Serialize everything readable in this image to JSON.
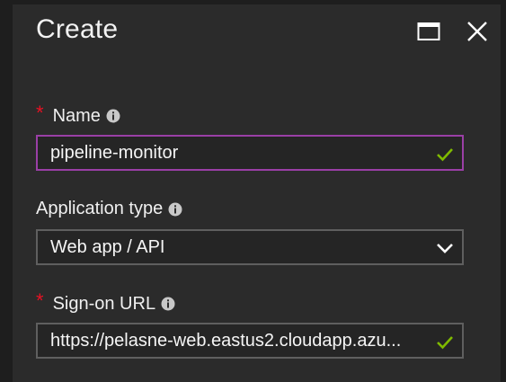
{
  "blade": {
    "title": "Create",
    "maximize_icon": "maximize-icon",
    "close_icon": "close-icon"
  },
  "form": {
    "name": {
      "label": "Name",
      "required": true,
      "value": "pipeline-monitor",
      "status_icon": "checkmark-icon",
      "focused": true
    },
    "application_type": {
      "label": "Application type",
      "required": false,
      "selected": "Web app / API",
      "icon": "chevron-down-icon"
    },
    "sign_on_url": {
      "label": "Sign-on URL",
      "required": true,
      "value": "https://pelasne-web.eastus2.cloudapp.azu...",
      "status_icon": "checkmark-icon"
    }
  },
  "colors": {
    "background": "#2b2b2b",
    "required_star": "#e81123",
    "valid_check": "#7fba00",
    "focus_border": "#9a3fa6",
    "field_border": "#5f5f5f"
  }
}
